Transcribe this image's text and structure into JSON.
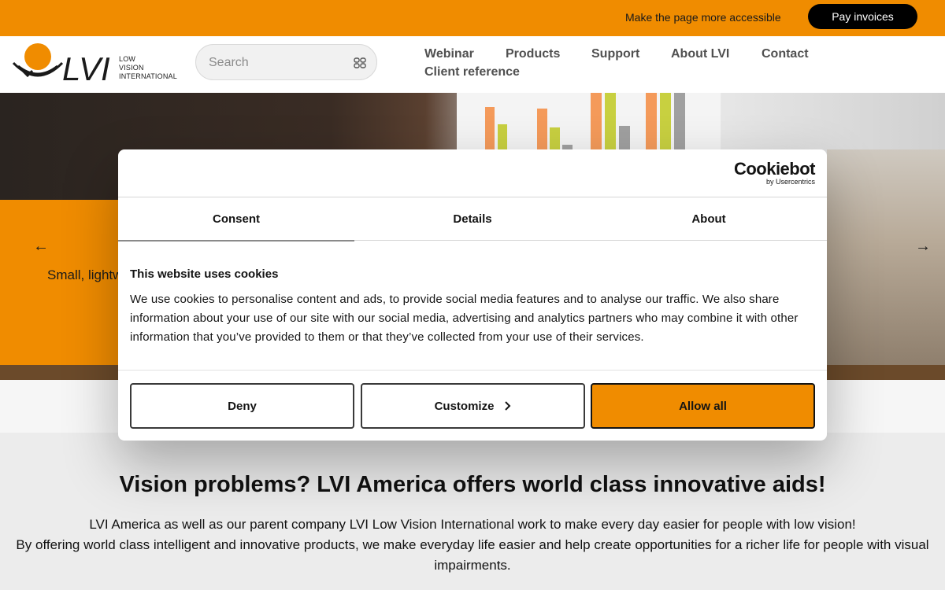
{
  "topbar": {
    "accessible_link": "Make the page more accessible",
    "pay_button": "Pay invoices"
  },
  "header": {
    "logo_lines": [
      "LOW",
      "VISION",
      "INTERNATIONAL"
    ],
    "logo_mark": "LVI",
    "search_placeholder": "Search",
    "nav": [
      "Webinar",
      "Products",
      "Support",
      "About LVI",
      "Contact",
      "Client reference"
    ]
  },
  "hero": {
    "caption": "Small, lightweight",
    "prev_arrow": "←",
    "next_arrow": "→"
  },
  "main": {
    "title": "Vision problems? LVI America offers world class innovative aids!",
    "paragraph_line1": "LVI America as well as our parent company LVI Low Vision International work to make every day easier for people with low vision!",
    "paragraph_line2": "By offering world class intelligent and innovative products, we make everyday life easier and help create opportunities for a richer life for people with visual impairments."
  },
  "cookie": {
    "brand": "Cookiebot",
    "brand_sub": "by Usercentrics",
    "tabs": [
      "Consent",
      "Details",
      "About"
    ],
    "active_tab": "Consent",
    "title": "This website uses cookies",
    "text": "We use cookies to personalise content and ads, to provide social media features and to analyse our traffic. We also share information about your use of our site with our social media, advertising and analytics partners who may combine it with other information that you’ve provided to them or that they’ve collected from your use of their services.",
    "buttons": {
      "deny": "Deny",
      "customize": "Customize",
      "allow": "Allow all"
    }
  },
  "colors": {
    "accent": "#f08c00",
    "dark": "#141414"
  }
}
